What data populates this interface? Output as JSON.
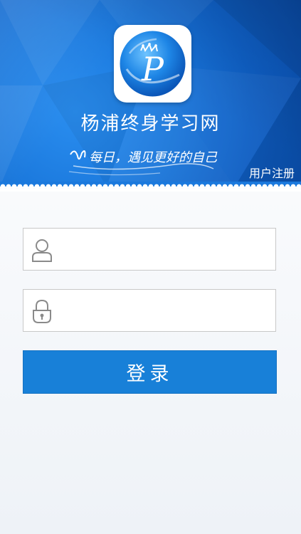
{
  "app": {
    "title": "杨浦终身学习网",
    "slogan": "每日，遇见更好的自己",
    "logo_letter": "P"
  },
  "header": {
    "register_label": "用户注册"
  },
  "form": {
    "username": {
      "value": "",
      "placeholder": "",
      "icon": "user-icon"
    },
    "password": {
      "value": "",
      "placeholder": "",
      "icon": "lock-icon"
    },
    "login_label": "登录"
  },
  "colors": {
    "banner_blue": "#1b79dd",
    "button_blue": "#1880d8",
    "text_white": "#ffffff"
  }
}
